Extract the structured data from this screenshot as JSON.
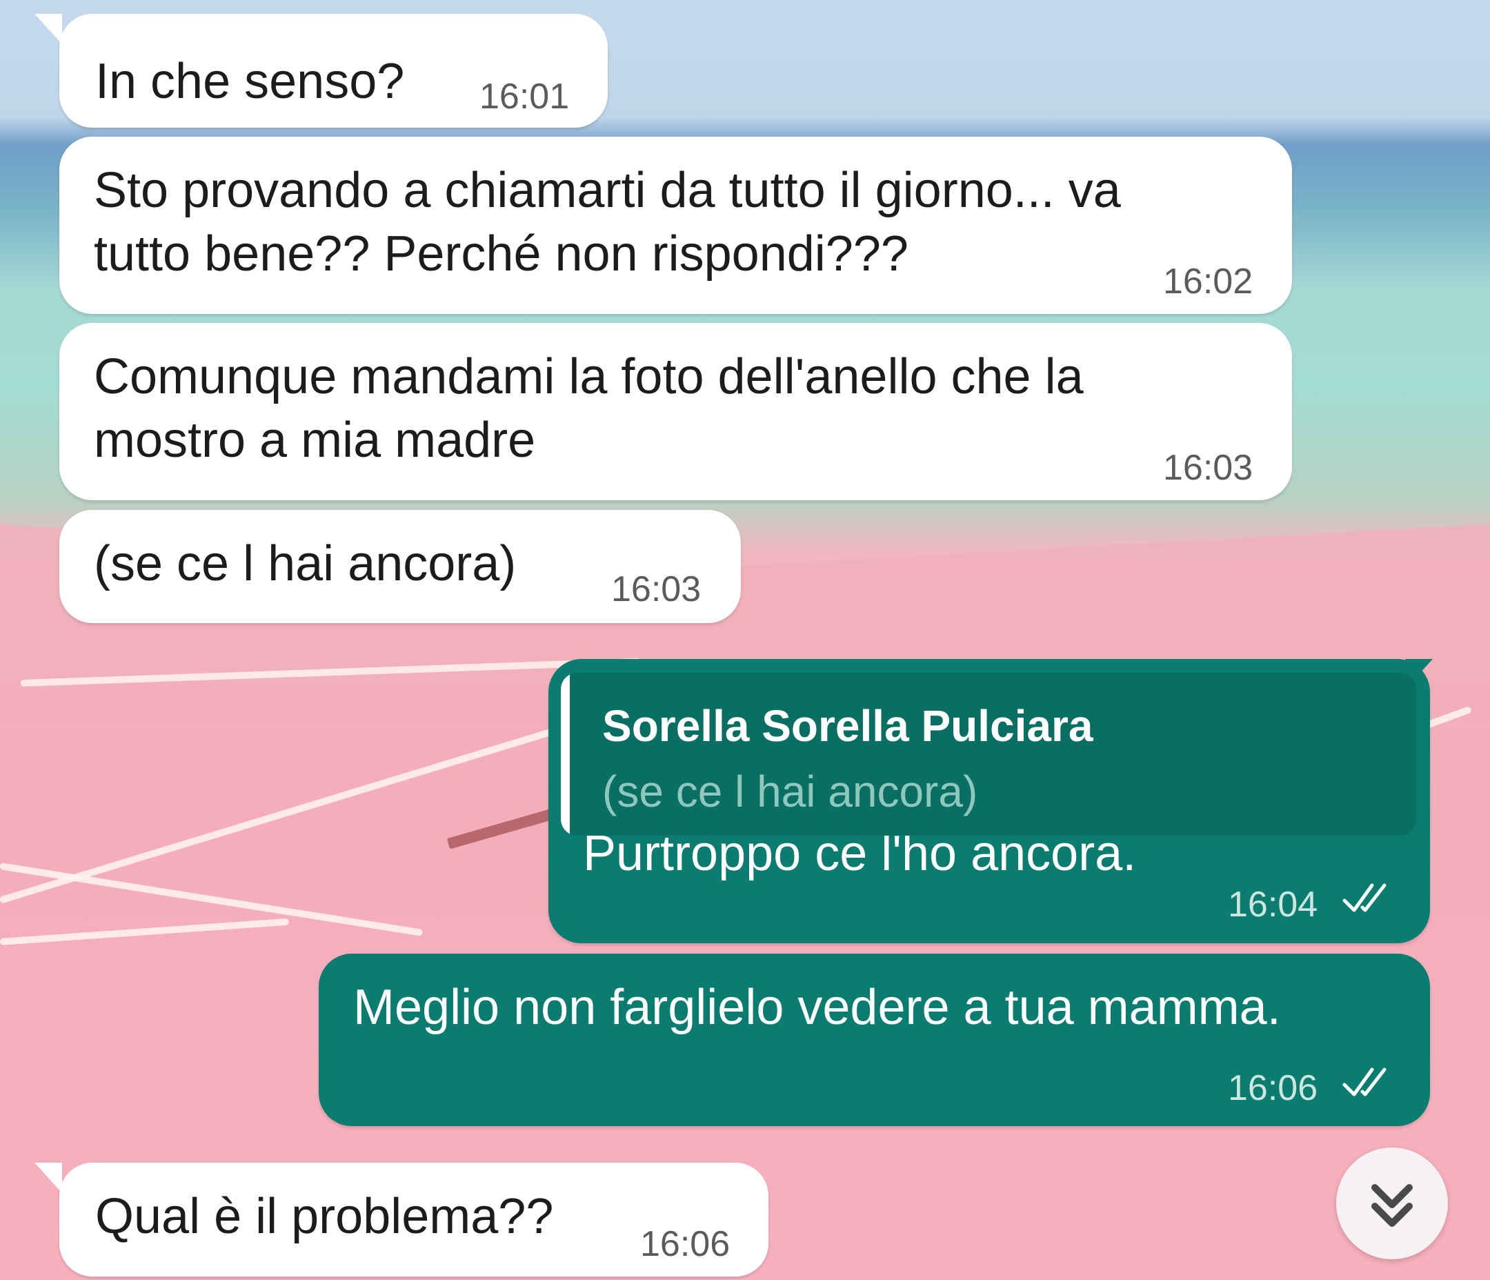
{
  "messages": [
    {
      "text": "In che senso?",
      "time": "16:01",
      "direction": "incoming"
    },
    {
      "line1": "Sto provando a chiamarti da tutto il giorno... va",
      "line2": "tutto bene?? Perché non rispondi???",
      "time": "16:02",
      "direction": "incoming"
    },
    {
      "line1": "Comunque mandami la foto dell'anello che la",
      "line2": "mostro a mia madre",
      "time": "16:03",
      "direction": "incoming"
    },
    {
      "text": "(se ce l hai ancora)",
      "time": "16:03",
      "direction": "incoming"
    },
    {
      "quote": {
        "author": "Sorella Sorella Pulciara",
        "text": "(se ce l hai ancora)"
      },
      "text": "Purtroppo ce l'ho ancora.",
      "time": "16:04",
      "direction": "outgoing",
      "status": "read"
    },
    {
      "text": "Meglio non farglielo vedere a tua mamma.",
      "time": "16:06",
      "direction": "outgoing",
      "status": "read"
    },
    {
      "text": "Qual è il problema??",
      "time": "16:06",
      "direction": "incoming"
    }
  ],
  "scroll_button": {
    "icon": "double-chevron-down-icon"
  },
  "colors": {
    "incoming_bubble": "#ffffff",
    "outgoing_bubble": "#0a7d70",
    "quote_bar": "#ffffff"
  }
}
